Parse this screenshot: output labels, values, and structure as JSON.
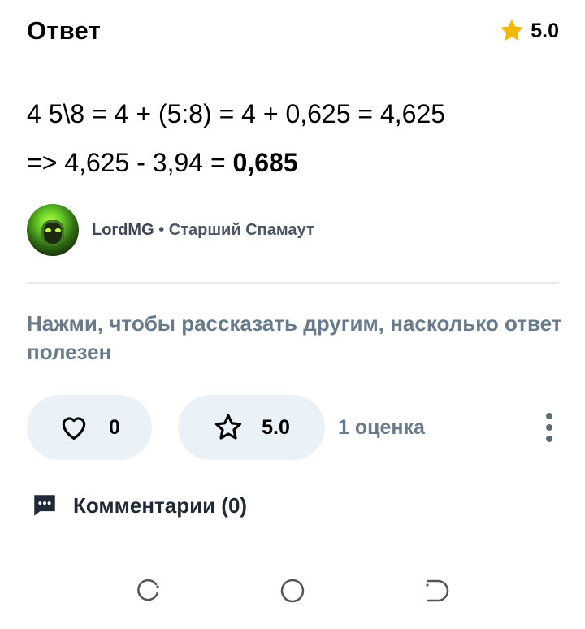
{
  "header": {
    "title": "Ответ",
    "rating_value": "5.0",
    "rating_icon": "star-icon"
  },
  "answer": {
    "line1": "4 5\\8 = 4 + (5:8) = 4 + 0,625 = 4,625",
    "line2_prefix": "=> 4,625 - 3,94 = ",
    "line2_result": "0,685"
  },
  "author": {
    "name": "LordMG",
    "separator": "•",
    "rank": "Старший Спамаут"
  },
  "prompt": {
    "text": "Нажми, чтобы рассказать другим, насколько ответ полезен"
  },
  "actions": {
    "likes_count": "0",
    "rating_value": "5.0",
    "ratings_label": "1 оценка"
  },
  "comments": {
    "label": "Комментарии (0)"
  },
  "colors": {
    "accent_star": "#f5b800",
    "pill_bg": "#ebf2f7",
    "muted_text": "#687b8c"
  }
}
